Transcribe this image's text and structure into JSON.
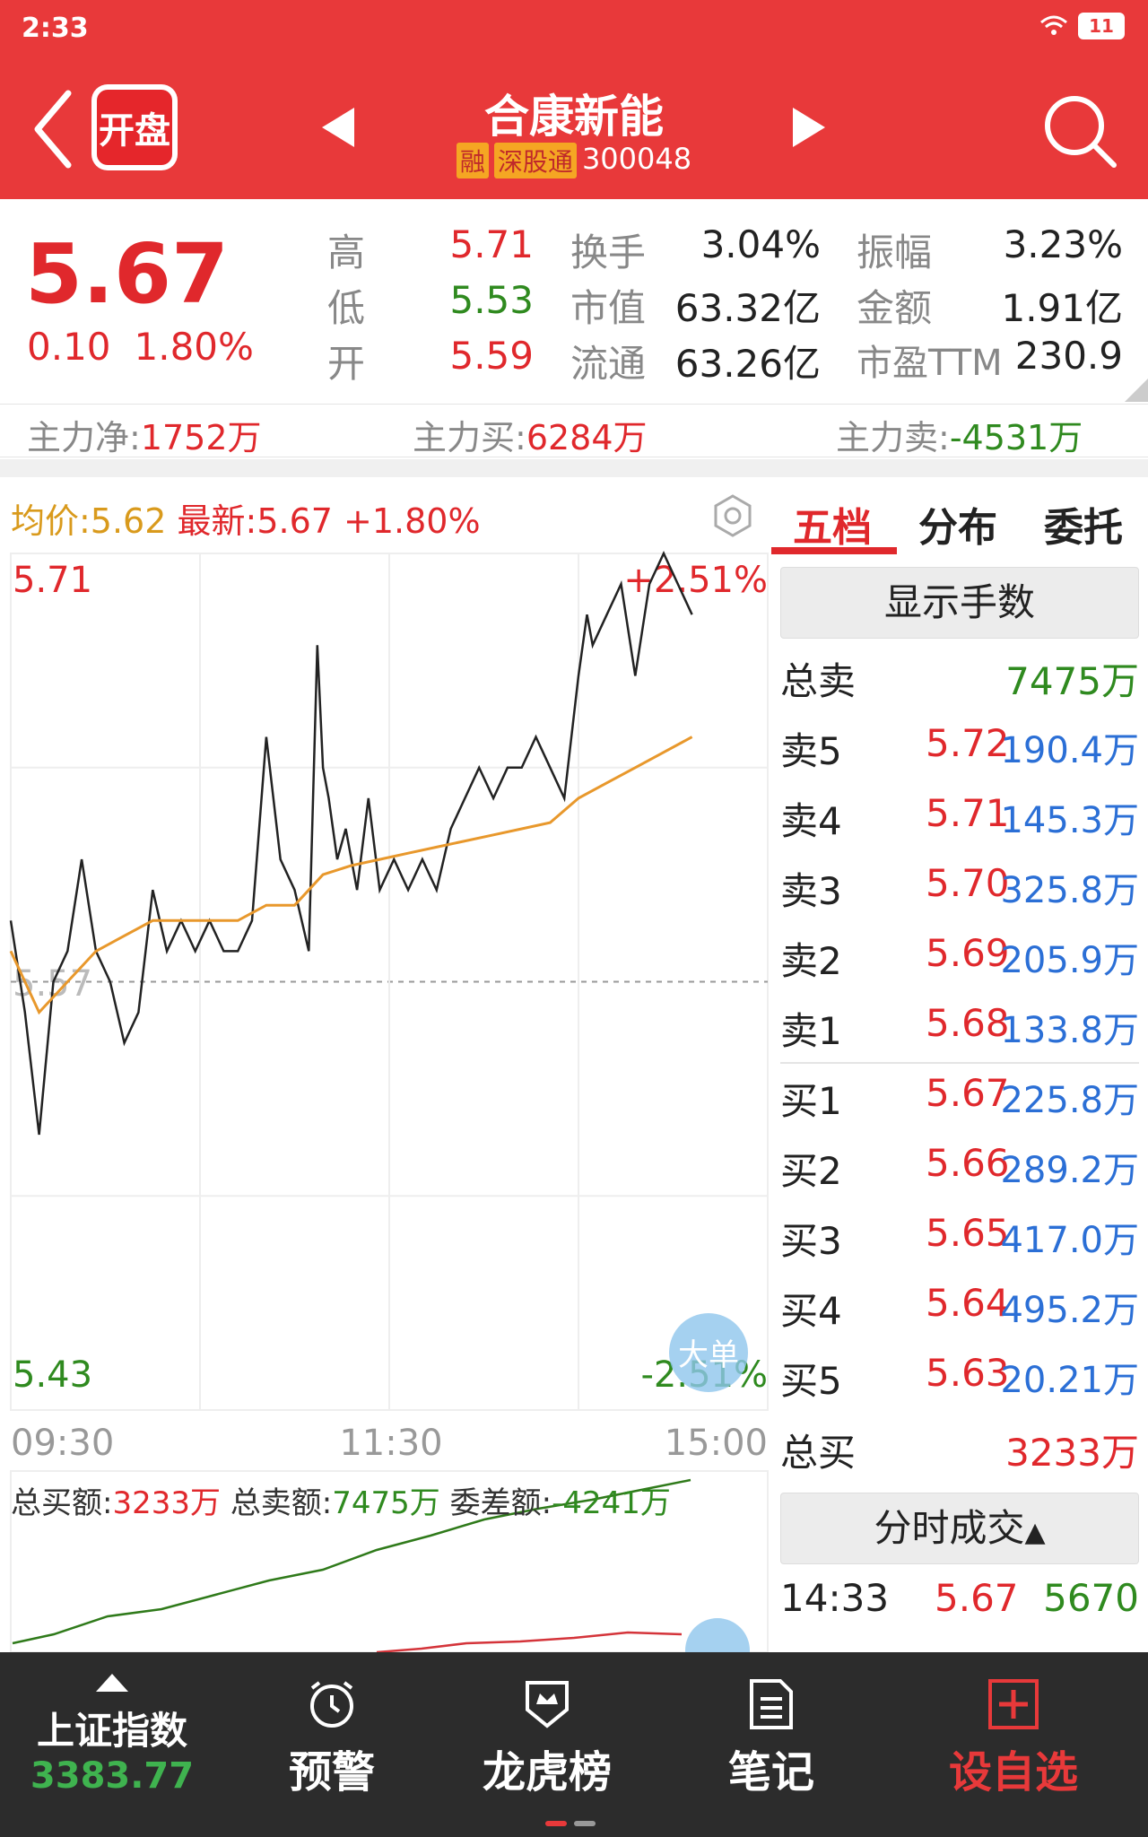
{
  "status_bar": {
    "time": "2:33",
    "battery": "11"
  },
  "header": {
    "logo_text": "开盘",
    "stock_name": "合康新能",
    "tag_margin": "融",
    "tag_connect": "深股通",
    "stock_code": "300048"
  },
  "quote": {
    "price": "5.67",
    "change": "0.10",
    "change_pct": "1.80%",
    "high_label": "高",
    "high": "5.71",
    "low_label": "低",
    "low": "5.53",
    "open_label": "开",
    "open": "5.59",
    "turnover_label": "换手",
    "turnover": "3.04%",
    "mktcap_label": "市值",
    "mktcap": "63.32亿",
    "float_label": "流通",
    "float_cap": "63.26亿",
    "amplitude_label": "振幅",
    "amplitude": "3.23%",
    "amount_label": "金额",
    "amount": "1.91亿",
    "pe_label": "市盈TTM",
    "pe": "230.9"
  },
  "fund_flow": {
    "net_label": "主力净:",
    "net": "1752万",
    "buy_label": "主力买:",
    "buy": "6284万",
    "sell_label": "主力卖:",
    "sell": "-4531万"
  },
  "chart_header": {
    "avg_label": "均价:5.62",
    "latest_label": "最新:5.67",
    "latest_pct": "+1.80%"
  },
  "chart_data": {
    "type": "line",
    "title": "",
    "x_ticks": [
      "09:30",
      "11:30",
      "15:00"
    ],
    "ylim": [
      5.43,
      5.71
    ],
    "y_top_label": "5.71",
    "y_bottom_label": "5.43",
    "y_mid_label": "5.57",
    "pct_top_label": "+2.51%",
    "pct_bottom_label": "-2.51%",
    "series": [
      {
        "color": "#222222",
        "x": [
          0,
          5,
          10,
          15,
          20,
          25,
          30,
          35,
          40,
          45,
          50,
          55,
          60,
          65,
          70,
          75,
          80,
          85,
          90,
          95,
          100,
          105,
          108,
          110,
          112,
          115,
          118,
          122,
          126,
          130,
          135,
          140,
          145,
          150,
          155,
          160,
          165,
          170,
          175,
          180,
          185,
          190,
          195,
          200,
          203,
          205,
          210,
          215,
          220,
          225,
          230,
          235,
          240
        ],
        "values": [
          5.59,
          5.56,
          5.52,
          5.57,
          5.58,
          5.61,
          5.58,
          5.57,
          5.55,
          5.56,
          5.6,
          5.58,
          5.59,
          5.58,
          5.59,
          5.58,
          5.58,
          5.59,
          5.65,
          5.61,
          5.6,
          5.58,
          5.68,
          5.64,
          5.63,
          5.61,
          5.62,
          5.6,
          5.63,
          5.6,
          5.61,
          5.6,
          5.61,
          5.6,
          5.62,
          5.63,
          5.64,
          5.63,
          5.64,
          5.64,
          5.65,
          5.64,
          5.63,
          5.67,
          5.69,
          5.68,
          5.69,
          5.7,
          5.67,
          5.7,
          5.71,
          5.7,
          5.69
        ]
      },
      {
        "color": "#e8982c",
        "x": [
          0,
          10,
          20,
          30,
          40,
          50,
          60,
          70,
          80,
          90,
          100,
          105,
          110,
          120,
          130,
          140,
          150,
          160,
          170,
          180,
          190,
          200,
          210,
          220,
          230,
          240
        ],
        "values": [
          5.58,
          5.56,
          5.57,
          5.58,
          5.585,
          5.59,
          5.59,
          5.59,
          5.59,
          5.595,
          5.595,
          5.6,
          5.605,
          5.608,
          5.61,
          5.612,
          5.614,
          5.616,
          5.618,
          5.62,
          5.622,
          5.63,
          5.635,
          5.64,
          5.645,
          5.65
        ]
      }
    ]
  },
  "sub_chart": {
    "total_buy_label": "总买额:",
    "total_buy": "3233万",
    "total_sell_label": "总卖额:",
    "total_sell": "7475万",
    "diff_label": "委差额:",
    "diff": "-4241万",
    "big_order_label": "大单"
  },
  "order_panel": {
    "tabs": [
      "五档",
      "分布",
      "委托"
    ],
    "show_lots": "显示手数",
    "total_sell_label": "总卖",
    "total_sell": "7475万",
    "asks": [
      {
        "label": "卖5",
        "price": "5.72",
        "volume": "190.4万"
      },
      {
        "label": "卖4",
        "price": "5.71",
        "volume": "145.3万"
      },
      {
        "label": "卖3",
        "price": "5.70",
        "volume": "325.8万"
      },
      {
        "label": "卖2",
        "price": "5.69",
        "volume": "205.9万"
      },
      {
        "label": "卖1",
        "price": "5.68",
        "volume": "133.8万"
      }
    ],
    "bids": [
      {
        "label": "买1",
        "price": "5.67",
        "volume": "225.8万"
      },
      {
        "label": "买2",
        "price": "5.66",
        "volume": "289.2万"
      },
      {
        "label": "买3",
        "price": "5.65",
        "volume": "417.0万"
      },
      {
        "label": "买4",
        "price": "5.64",
        "volume": "495.2万"
      },
      {
        "label": "买5",
        "price": "5.63",
        "volume": "20.21万"
      }
    ],
    "total_buy_label": "总买",
    "total_buy": "3233万",
    "ticks_label": "分时成交",
    "trade": {
      "time": "14:33",
      "price": "5.67",
      "volume": "5670"
    }
  },
  "bottom_nav": {
    "index_label": "上证指数",
    "index_value": "3383.77",
    "alert": "预警",
    "dragon_tiger": "龙虎榜",
    "notes": "笔记",
    "add_watch": "设自选"
  },
  "colors": {
    "brand_red": "#e8393a",
    "up_red": "#e0282c",
    "down_green": "#2f8a1f",
    "volume_blue": "#2b6fd6",
    "avg_orange": "#e8982c"
  }
}
